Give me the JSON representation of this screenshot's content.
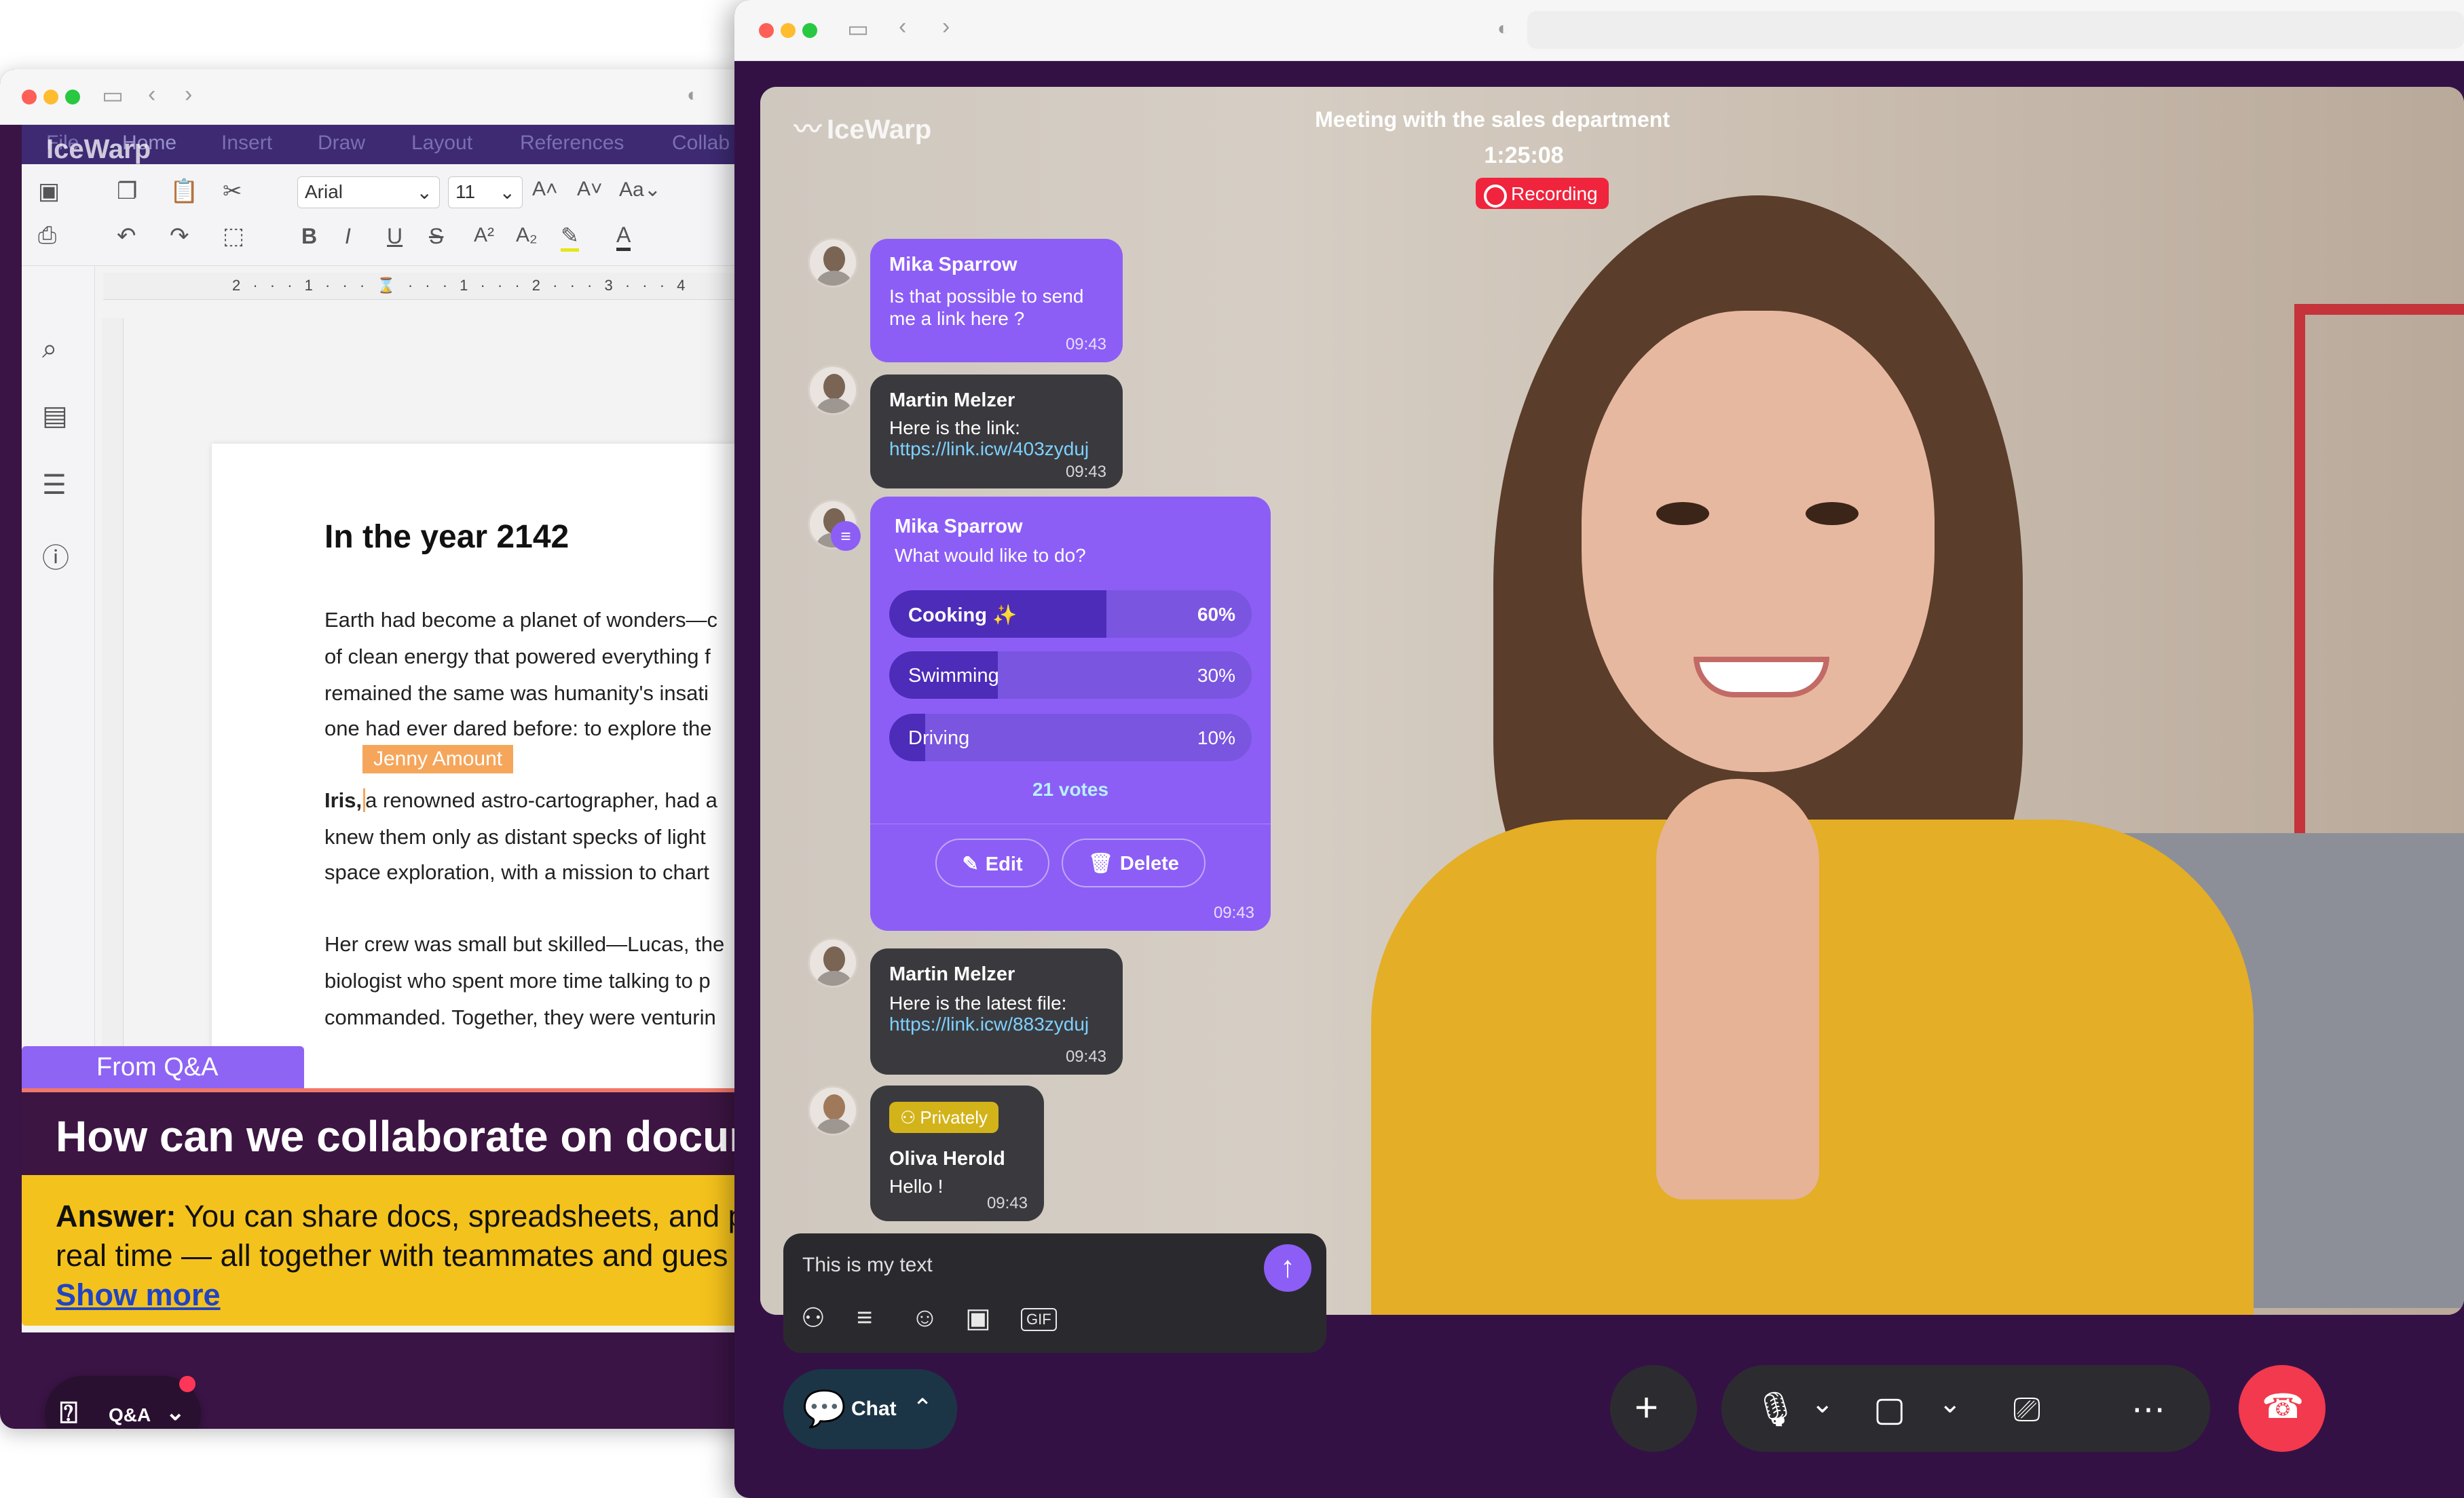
{
  "left_window": {
    "app_logo": "IceWarp",
    "menu_tabs": [
      "File",
      "Home",
      "Insert",
      "Draw",
      "Layout",
      "References",
      "Collab"
    ],
    "font_name": "Arial",
    "font_size": "11",
    "ruler_text": "2 · · · 1 · · · ⌛ · · · 1 · · · 2 · · · 3 · · · 4",
    "doc": {
      "heading": "In the year 2142",
      "lines": [
        "Earth had become a planet of wonders—c",
        "of clean energy that powered everything f",
        "remained the same was humanity's insati",
        "one had ever dared before: to explore the",
        "a renowned astro-cartographer, had a",
        "knew them only as distant specks of light",
        "space exploration, with a mission to chart",
        "Her crew was small but skilled—Lucas, the",
        "biologist who spent more time talking to p",
        "commanded. Together, they were venturin"
      ],
      "bold_name": "Iris,",
      "collab_cursor": "Jenny Amount"
    },
    "qa": {
      "tag": "From Q&A",
      "question": "How can we collaborate on docum",
      "answer_label": "Answer:",
      "answer_line1": " You can share docs, spreadsheets, and p",
      "answer_line2": "real time — all together with teammates and gues",
      "show_more": "Show more",
      "pill_label": "Q&A"
    }
  },
  "right_window": {
    "app_logo": "IceWarp",
    "meeting_title": "Meeting with the sales department",
    "timer": "1:25:08",
    "recording_label": "Recording",
    "messages": [
      {
        "name": "Mika Sparrow",
        "line1": "Is that possible to send",
        "line2": "me a link here ?",
        "time": "09:43"
      },
      {
        "name": "Martin Melzer",
        "line1": "Here is the link:",
        "link": "https://link.icw/403zyduj",
        "time": "09:43"
      },
      {
        "name": "Martin Melzer",
        "line1": "Here is the latest file:",
        "link": "https://link.icw/883zyduj",
        "time": "09:43"
      },
      {
        "badge": "Privately",
        "name": "Oliva Herold",
        "line1": "Hello !",
        "time": "09:43"
      }
    ],
    "poll": {
      "name": "Mika Sparrow",
      "question": "What would like to do?",
      "options": [
        {
          "label": "Cooking ✨",
          "pct": "60%",
          "value": 0.6
        },
        {
          "label": "Swimming",
          "pct": "30%",
          "value": 0.3
        },
        {
          "label": "Driving",
          "pct": "10%",
          "value": 0.1
        }
      ],
      "votes": "21 votes",
      "edit_label": "Edit",
      "delete_label": "Delete",
      "time": "09:43"
    },
    "composer": {
      "text": "This is my text"
    },
    "chat_button_label": "Chat",
    "reactions": [
      "😀",
      "🤣",
      "😇",
      "😢",
      "😳",
      "👍",
      "💩",
      "😡",
      "❤️",
      "😎",
      "🤩"
    ]
  }
}
